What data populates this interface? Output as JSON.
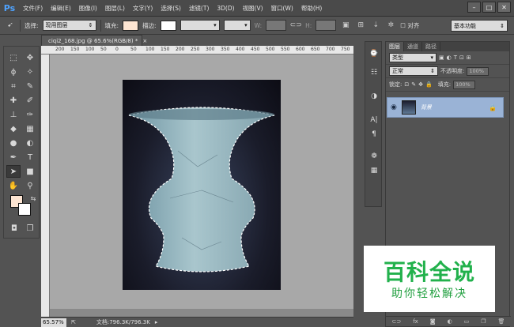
{
  "app": {
    "logo": "Ps"
  },
  "menus": [
    "文件(F)",
    "编辑(E)",
    "图像(I)",
    "图层(L)",
    "文字(Y)",
    "选择(S)",
    "滤镜(T)",
    "3D(D)",
    "视图(V)",
    "窗口(W)",
    "帮助(H)"
  ],
  "window_controls": {
    "minimize": "–",
    "restore": "□",
    "close": "✕"
  },
  "options": {
    "select_label": "选择:",
    "select_value": "现用图层",
    "fill_label": "填充:",
    "stroke_label": "描边:",
    "w_label": "W:",
    "h_label": "H:",
    "align_label": "对齐",
    "fill_color": "#fde5d2"
  },
  "workspace": {
    "value": "基本功能"
  },
  "document": {
    "tab_title": "ciqi2_168.jpg @ 65.6%(RGB/8) *",
    "zoom": "65.57%",
    "doc_info": "文档:796.3K/796.3K",
    "ruler_ticks": [
      "200",
      "150",
      "100",
      "50",
      "0",
      "50",
      "100",
      "150",
      "200",
      "250",
      "300",
      "350",
      "400",
      "450",
      "500",
      "550",
      "600",
      "650",
      "700",
      "750"
    ]
  },
  "colors": {
    "foreground": "#fde5d2",
    "background": "#ffffff"
  },
  "layers": {
    "tabs": [
      "图层",
      "通道",
      "路径"
    ],
    "kind_label": "类型",
    "blend_mode": "正常",
    "opacity_label": "不透明度:",
    "opacity_value": "100%",
    "lock_label": "锁定:",
    "fill_label": "填充:",
    "fill_value": "100%",
    "layer_name": "背景",
    "bottom_icons": [
      "link-icon",
      "fx-icon",
      "mask-icon",
      "adjustment-icon",
      "folder-icon",
      "new-layer-icon",
      "trash-icon"
    ]
  },
  "watermark": {
    "title": "百科全说",
    "subtitle": "助你轻松解决"
  }
}
